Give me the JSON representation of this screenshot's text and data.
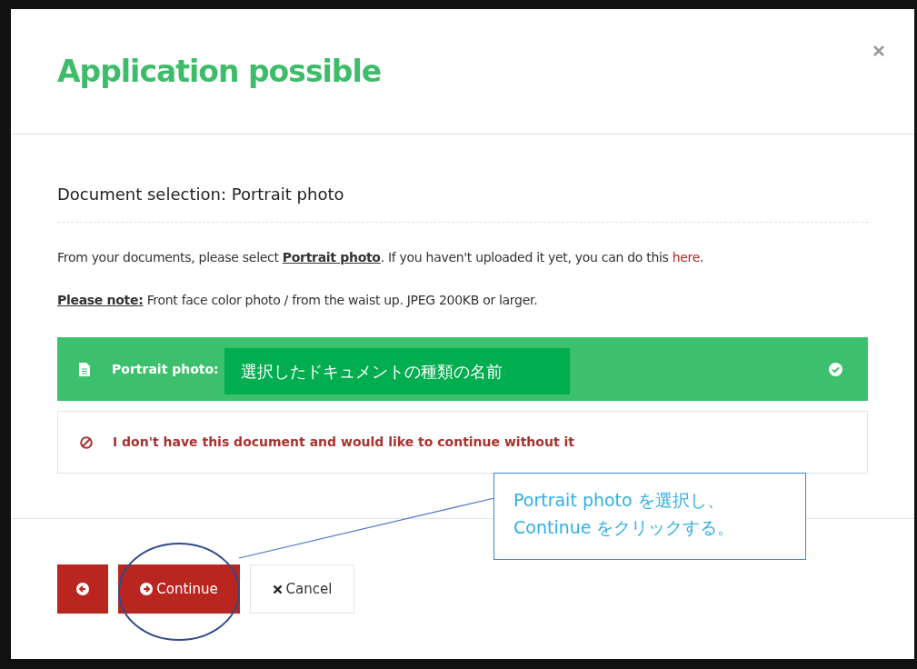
{
  "dialog": {
    "title": "Application possible",
    "section_heading": "Document selection: Portrait photo",
    "intro": {
      "before": "From your documents, please select ",
      "highlight": "Portrait photo",
      "middle": ". If you haven't uploaded it yet, you can do this ",
      "link": "here",
      "after": "."
    },
    "note": {
      "label": "Please note:",
      "text": " Front face color photo / from the waist up. JPEG 200KB or larger."
    },
    "options": [
      {
        "kind": "document",
        "label": "Portrait photo:",
        "selected": true
      },
      {
        "kind": "skip",
        "label": "I don't have this document and would like to continue without it",
        "selected": false
      }
    ],
    "buttons": [
      {
        "kind": "back"
      },
      {
        "kind": "continue",
        "label": "Continue"
      },
      {
        "kind": "cancel",
        "label": "Cancel"
      }
    ]
  },
  "annotations": {
    "field_label": "選択したドキュメントの種類の名前",
    "callout": [
      "Portrait photo を選択し、",
      "Continue をクリックする。"
    ]
  }
}
